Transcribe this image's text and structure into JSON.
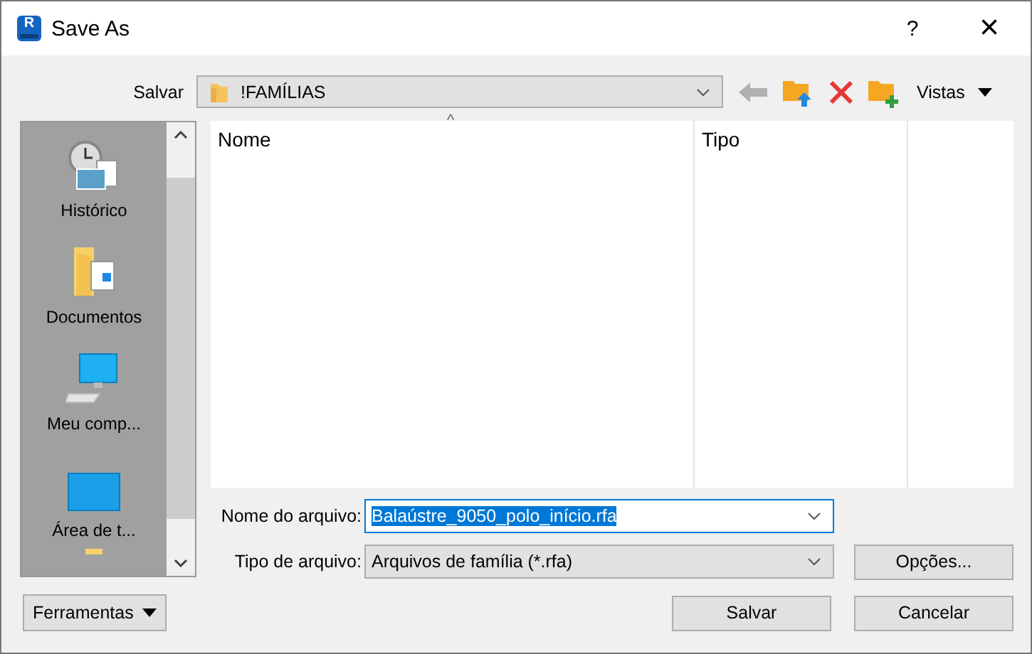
{
  "window": {
    "title": "Save As",
    "app_icon_letter": "R",
    "help": "?",
    "close": "×"
  },
  "location": {
    "label": "Salvar",
    "value": "!FAMÍLIAS"
  },
  "views_button": {
    "label": "Vistas"
  },
  "places": [
    {
      "kind": "history",
      "label": "Histórico"
    },
    {
      "kind": "documents",
      "label": "Documentos"
    },
    {
      "kind": "computer",
      "label": "Meu comp..."
    },
    {
      "kind": "desktop",
      "label": "Área de t..."
    },
    {
      "kind": "folder"
    }
  ],
  "file_list": {
    "columns": [
      "Nome",
      "Tipo"
    ],
    "sort_indicator": "^"
  },
  "file_name": {
    "label": "Nome do arquivo:",
    "value": "Balaústre_9050_polo_início.rfa",
    "selected": true
  },
  "file_type": {
    "label": "Tipo de arquivo:",
    "value": "Arquivos de família  (*.rfa)"
  },
  "buttons": {
    "options": "Opções...",
    "tools": "Ferramentas",
    "save": "Salvar",
    "cancel": "Cancelar"
  }
}
